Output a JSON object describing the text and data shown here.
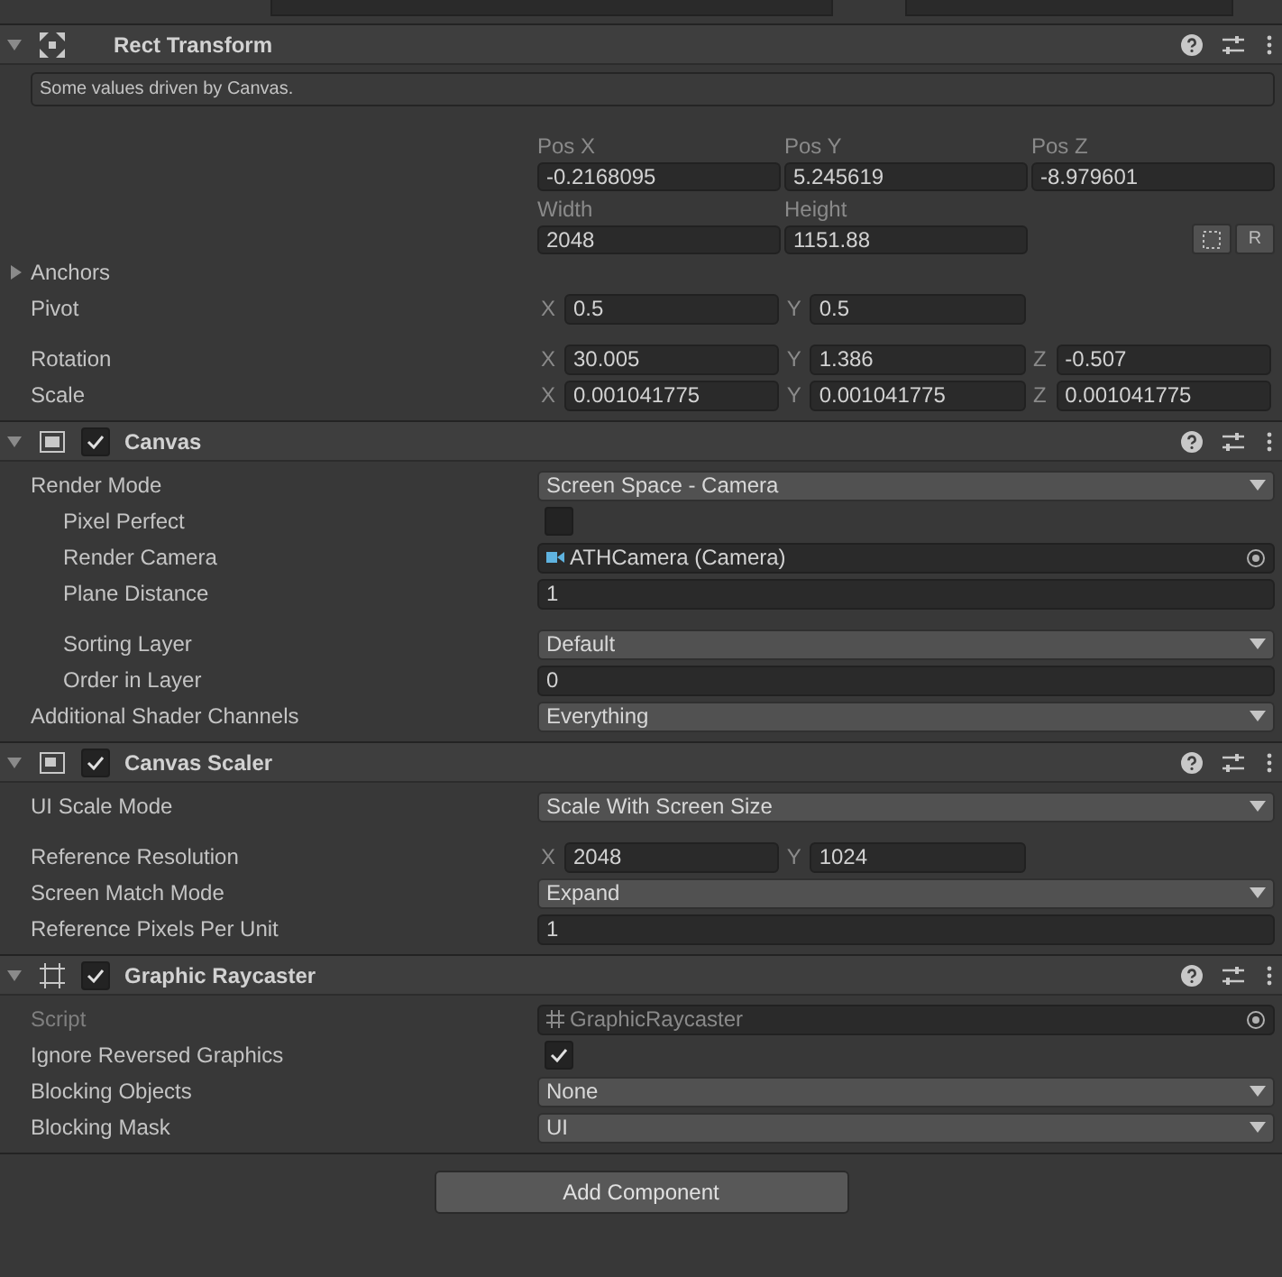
{
  "components": [
    {
      "title": "Rect Transform",
      "kind": "rect_transform",
      "expanded": true,
      "rows": [
        {
          "kind": "notice",
          "text": "Some values driven by Canvas."
        },
        {
          "kind": "grid",
          "cells": [
            {
              "label": "Pos X",
              "value": "-0.2168095"
            },
            {
              "label": "Pos Y",
              "value": "5.245619"
            },
            {
              "label": "Pos Z",
              "value": "-8.979601"
            }
          ]
        },
        {
          "kind": "grid",
          "cells": [
            {
              "label": "Width",
              "value": "2048"
            },
            {
              "label": "Height",
              "value": "1151.88"
            }
          ],
          "buttons": [
            {
              "kind": "blueprint"
            },
            {
              "kind": "text",
              "text": "R"
            }
          ]
        },
        {
          "kind": "foldout",
          "label": "Anchors",
          "expanded": false
        },
        {
          "kind": "vector",
          "label": "Pivot",
          "fields": [
            {
              "axis": "X",
              "value": "0.5"
            },
            {
              "axis": "Y",
              "value": "0.5"
            }
          ]
        },
        {
          "kind": "vector",
          "label": "Rotation",
          "fields": [
            {
              "axis": "X",
              "value": "30.005"
            },
            {
              "axis": "Y",
              "value": "1.386"
            },
            {
              "axis": "Z",
              "value": "-0.507"
            }
          ],
          "spaced": true
        },
        {
          "kind": "vector",
          "label": "Scale",
          "fields": [
            {
              "axis": "X",
              "value": "0.001041775"
            },
            {
              "axis": "Y",
              "value": "0.001041775"
            },
            {
              "axis": "Z",
              "value": "0.001041775"
            }
          ]
        }
      ]
    },
    {
      "title": "Canvas",
      "kind": "canvas",
      "enabled": true,
      "expanded": true,
      "rows": [
        {
          "kind": "dropdown",
          "label": "Render Mode",
          "value": "Screen Space - Camera"
        },
        {
          "kind": "checkbox",
          "label": "Pixel Perfect",
          "checked": false,
          "indented": true
        },
        {
          "kind": "camera_ref",
          "label": "Render Camera",
          "value": "ATHCamera (Camera)",
          "indented": true
        },
        {
          "kind": "input",
          "label": "Plane Distance",
          "value": "1",
          "indented": true
        },
        {
          "kind": "dropdown",
          "label": "Sorting Layer",
          "value": "Default",
          "indented": true,
          "spaced": true
        },
        {
          "kind": "input",
          "label": "Order in Layer",
          "value": "0",
          "indented": true
        },
        {
          "kind": "dropdown",
          "label": "Additional Shader Channels",
          "value": "Everything"
        }
      ]
    },
    {
      "title": "Canvas Scaler",
      "kind": "canvas_scaler",
      "enabled": true,
      "expanded": true,
      "rows": [
        {
          "kind": "dropdown",
          "label": "UI Scale Mode",
          "value": "Scale With Screen Size"
        },
        {
          "kind": "vector",
          "label": "Reference Resolution",
          "fields": [
            {
              "axis": "X",
              "value": "2048"
            },
            {
              "axis": "Y",
              "value": "1024"
            }
          ],
          "spaced": true
        },
        {
          "kind": "dropdown",
          "label": "Screen Match Mode",
          "value": "Expand"
        },
        {
          "kind": "input",
          "label": "Reference Pixels Per Unit",
          "value": "1"
        }
      ]
    },
    {
      "title": "Graphic Raycaster",
      "kind": "raycaster",
      "enabled": true,
      "expanded": true,
      "rows": [
        {
          "kind": "script_ref",
          "label": "Script",
          "value": "GraphicRaycaster",
          "disabled": true
        },
        {
          "kind": "checkbox",
          "label": "Ignore Reversed Graphics",
          "checked": true
        },
        {
          "kind": "dropdown",
          "label": "Blocking Objects",
          "value": "None"
        },
        {
          "kind": "dropdown",
          "label": "Blocking Mask",
          "value": "UI"
        }
      ]
    }
  ],
  "add_button": "Add Component"
}
